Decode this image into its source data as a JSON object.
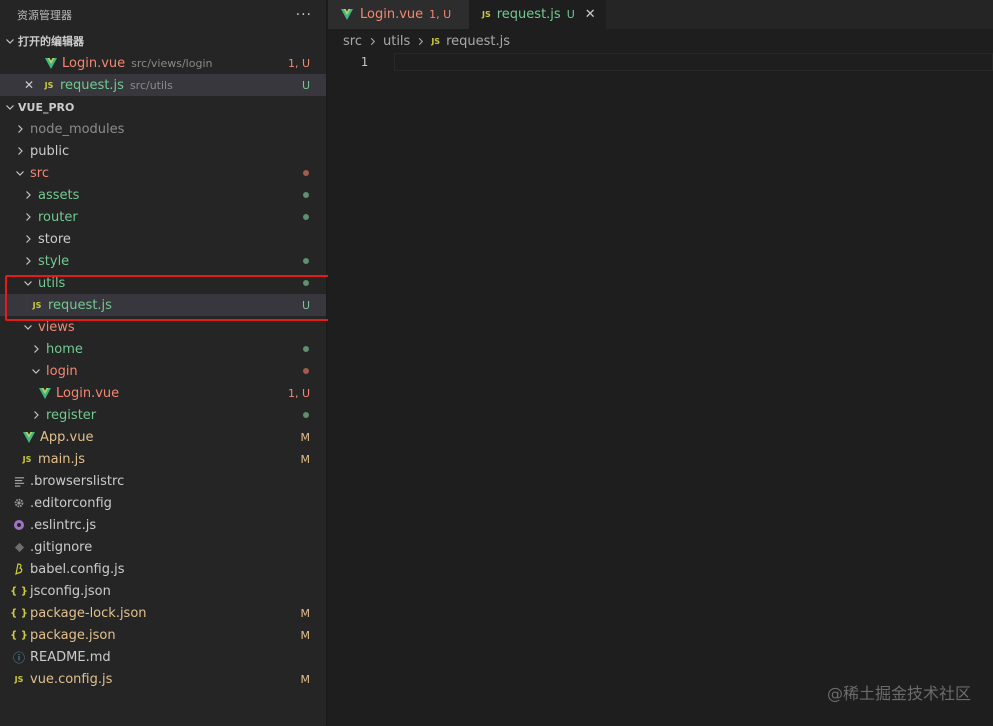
{
  "explorer": {
    "title": "资源管理器",
    "more": "···"
  },
  "open_editors": {
    "title": "打开的编辑器",
    "items": [
      {
        "name": "Login.vue",
        "path": "src/views/login",
        "badge": "1, U"
      },
      {
        "name": "request.js",
        "path": "src/utils",
        "badge": "U",
        "close": "✕"
      }
    ]
  },
  "project": {
    "title": "VUE_PRO",
    "tree": [
      {
        "label": "node_modules"
      },
      {
        "label": "public"
      },
      {
        "label": "src"
      },
      {
        "label": "assets"
      },
      {
        "label": "router"
      },
      {
        "label": "store"
      },
      {
        "label": "style"
      },
      {
        "label": "utils"
      },
      {
        "label": "request.js",
        "badge": "U"
      },
      {
        "label": "views"
      },
      {
        "label": "home"
      },
      {
        "label": "login"
      },
      {
        "label": "Login.vue",
        "badge": "1, U"
      },
      {
        "label": "register"
      },
      {
        "label": "App.vue",
        "badge": "M"
      },
      {
        "label": "main.js",
        "badge": "M"
      },
      {
        "label": ".browserslistrc"
      },
      {
        "label": ".editorconfig"
      },
      {
        "label": ".eslintrc.js"
      },
      {
        "label": ".gitignore"
      },
      {
        "label": "babel.config.js"
      },
      {
        "label": "jsconfig.json"
      },
      {
        "label": "package-lock.json",
        "badge": "M"
      },
      {
        "label": "package.json",
        "badge": "M"
      },
      {
        "label": "README.md"
      },
      {
        "label": "vue.config.js",
        "badge": "M"
      }
    ]
  },
  "icons": {
    "js": "JS",
    "json": "{ }",
    "info": "ⓘ"
  },
  "tabs": [
    {
      "label": "Login.vue",
      "badge": "1, U"
    },
    {
      "label": "request.js",
      "badge": "U",
      "close": "✕"
    }
  ],
  "breadcrumb": [
    "src",
    "utils",
    "request.js"
  ],
  "editor": {
    "line_number": "1"
  },
  "watermark": "@稀土掘金技术社区",
  "colors": {
    "sidebar_bg": "#252526",
    "editor_bg": "#1e1e1e",
    "untracked": "#73c991",
    "error": "#f48771",
    "modified": "#e2c08d",
    "highlight_box": "#e51a1a"
  }
}
